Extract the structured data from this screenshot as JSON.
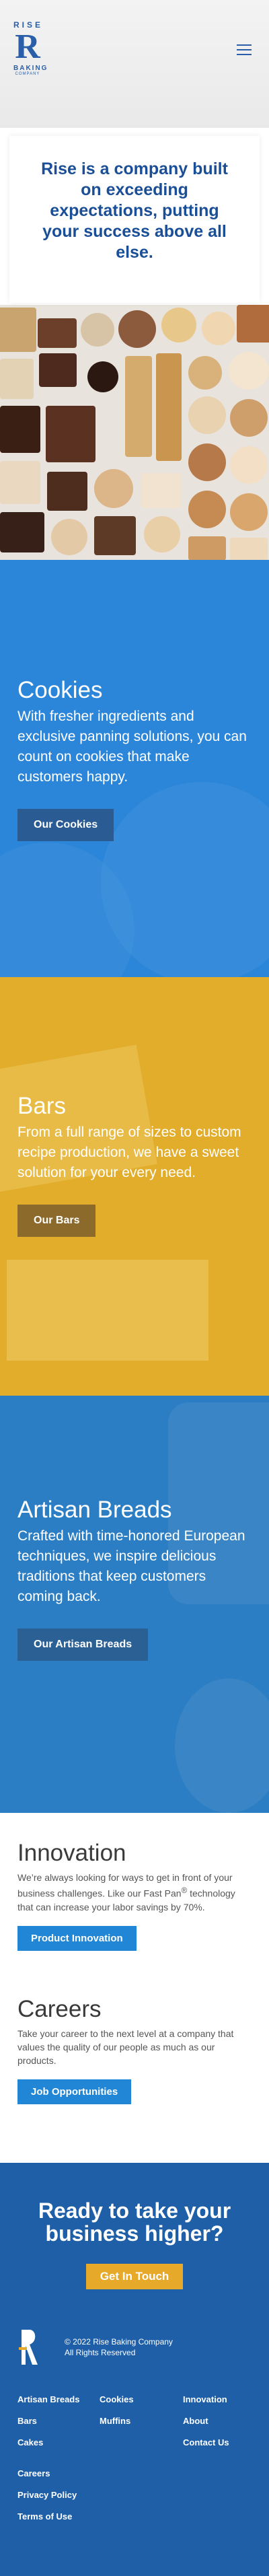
{
  "header": {
    "logo_top": "RISE",
    "logo_mark": "R",
    "logo_bottom": "BAKING",
    "logo_sub": "COMPANY"
  },
  "hero": {
    "statement": "Rise is a company built on exceeding expectations, putting your success above all else."
  },
  "sections": {
    "cookies": {
      "title": "Cookies",
      "text": "With fresher ingredients and exclusive panning solutions, you can count on cookies that make customers happy.",
      "button": "Our Cookies"
    },
    "bars": {
      "title": "Bars",
      "text": "From a full range of sizes to custom recipe production, we have a sweet solution for your every need.",
      "button": "Our Bars"
    },
    "breads": {
      "title": "Artisan Breads",
      "text": "Crafted with time-honored European techniques, we inspire delicious traditions that keep customers coming back.",
      "button": "Our Artisan Breads"
    }
  },
  "innovation": {
    "title": "Innovation",
    "text_pre": "We’re always looking for ways to get in front of your business challenges. Like our Fast Pan",
    "text_mark": "®",
    "text_post": " technology that can increase your labor savings by 70%.",
    "button": "Product Innovation"
  },
  "careers": {
    "title": "Careers",
    "text": "Take your career to the next level at a company that values the quality of our people as much as our products.",
    "button": "Job Opportunities"
  },
  "cta": {
    "title": "Ready to take your business higher?",
    "button": "Get In Touch"
  },
  "footer": {
    "copyright": "© 2022 Rise Baking Company",
    "rights": "All Rights Reserved",
    "links": [
      "Artisan Breads",
      "Cookies",
      "Innovation",
      "Bars",
      "Muffins",
      "About",
      "Cakes",
      "Contact Us",
      "Careers",
      "Privacy Policy",
      "Terms of Use"
    ]
  },
  "colors": {
    "brand_blue": "#2a5ea8",
    "cookies_bg": "#2b86d9",
    "bars_bg": "#e3ad2c",
    "breads_bg": "#2b7ec4",
    "cta_bg": "#1f5fa8",
    "accent_yellow": "#e7a929"
  },
  "icons": {
    "menu": "hamburger-icon"
  }
}
